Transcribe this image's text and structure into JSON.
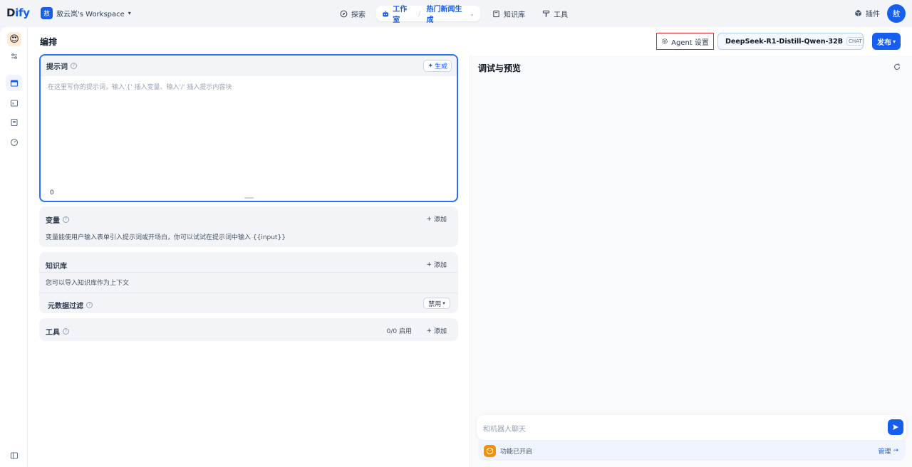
{
  "header": {
    "logo_main": "D",
    "logo_rest": "ify",
    "workspace_initial": "敖",
    "workspace_name": "敖云岚's Workspace",
    "nav": {
      "explore": "探索",
      "studio": "工作室",
      "app_name": "热门新闻生成",
      "knowledge": "知识库",
      "tools": "工具"
    },
    "plugins": "插件",
    "user_initial": "敖"
  },
  "page": {
    "title": "编排",
    "agent_settings": "Agent 设置",
    "model_name": "DeepSeek-R1-Distill-Qwen-32B",
    "model_mode": "CHAT",
    "publish": "发布"
  },
  "prompt": {
    "label": "提示词",
    "generate": "生成",
    "placeholder": "在这里写你的提示词，输入'{' 插入变量、输入'/' 插入提示内容块",
    "count": "0"
  },
  "variables": {
    "label": "变量",
    "add": "添加",
    "desc": "变量能使用户输入表单引入提示词或开场白，你可以试试在提示词中输入 {{input}}"
  },
  "knowledge": {
    "label": "知识库",
    "add": "添加",
    "desc": "您可以导入知识库作为上下文",
    "metadata_label": "元数据过滤",
    "metadata_value": "禁用"
  },
  "tools": {
    "label": "工具",
    "count": "0/0 启用",
    "add": "添加"
  },
  "debug": {
    "title": "调试与预览",
    "chat_placeholder": "和机器人聊天",
    "features_text": "功能已开启",
    "manage": "管理"
  },
  "colors": {
    "accent": "#155eef",
    "highlight_border": "#d92d20",
    "features_icon": "#f79009"
  }
}
